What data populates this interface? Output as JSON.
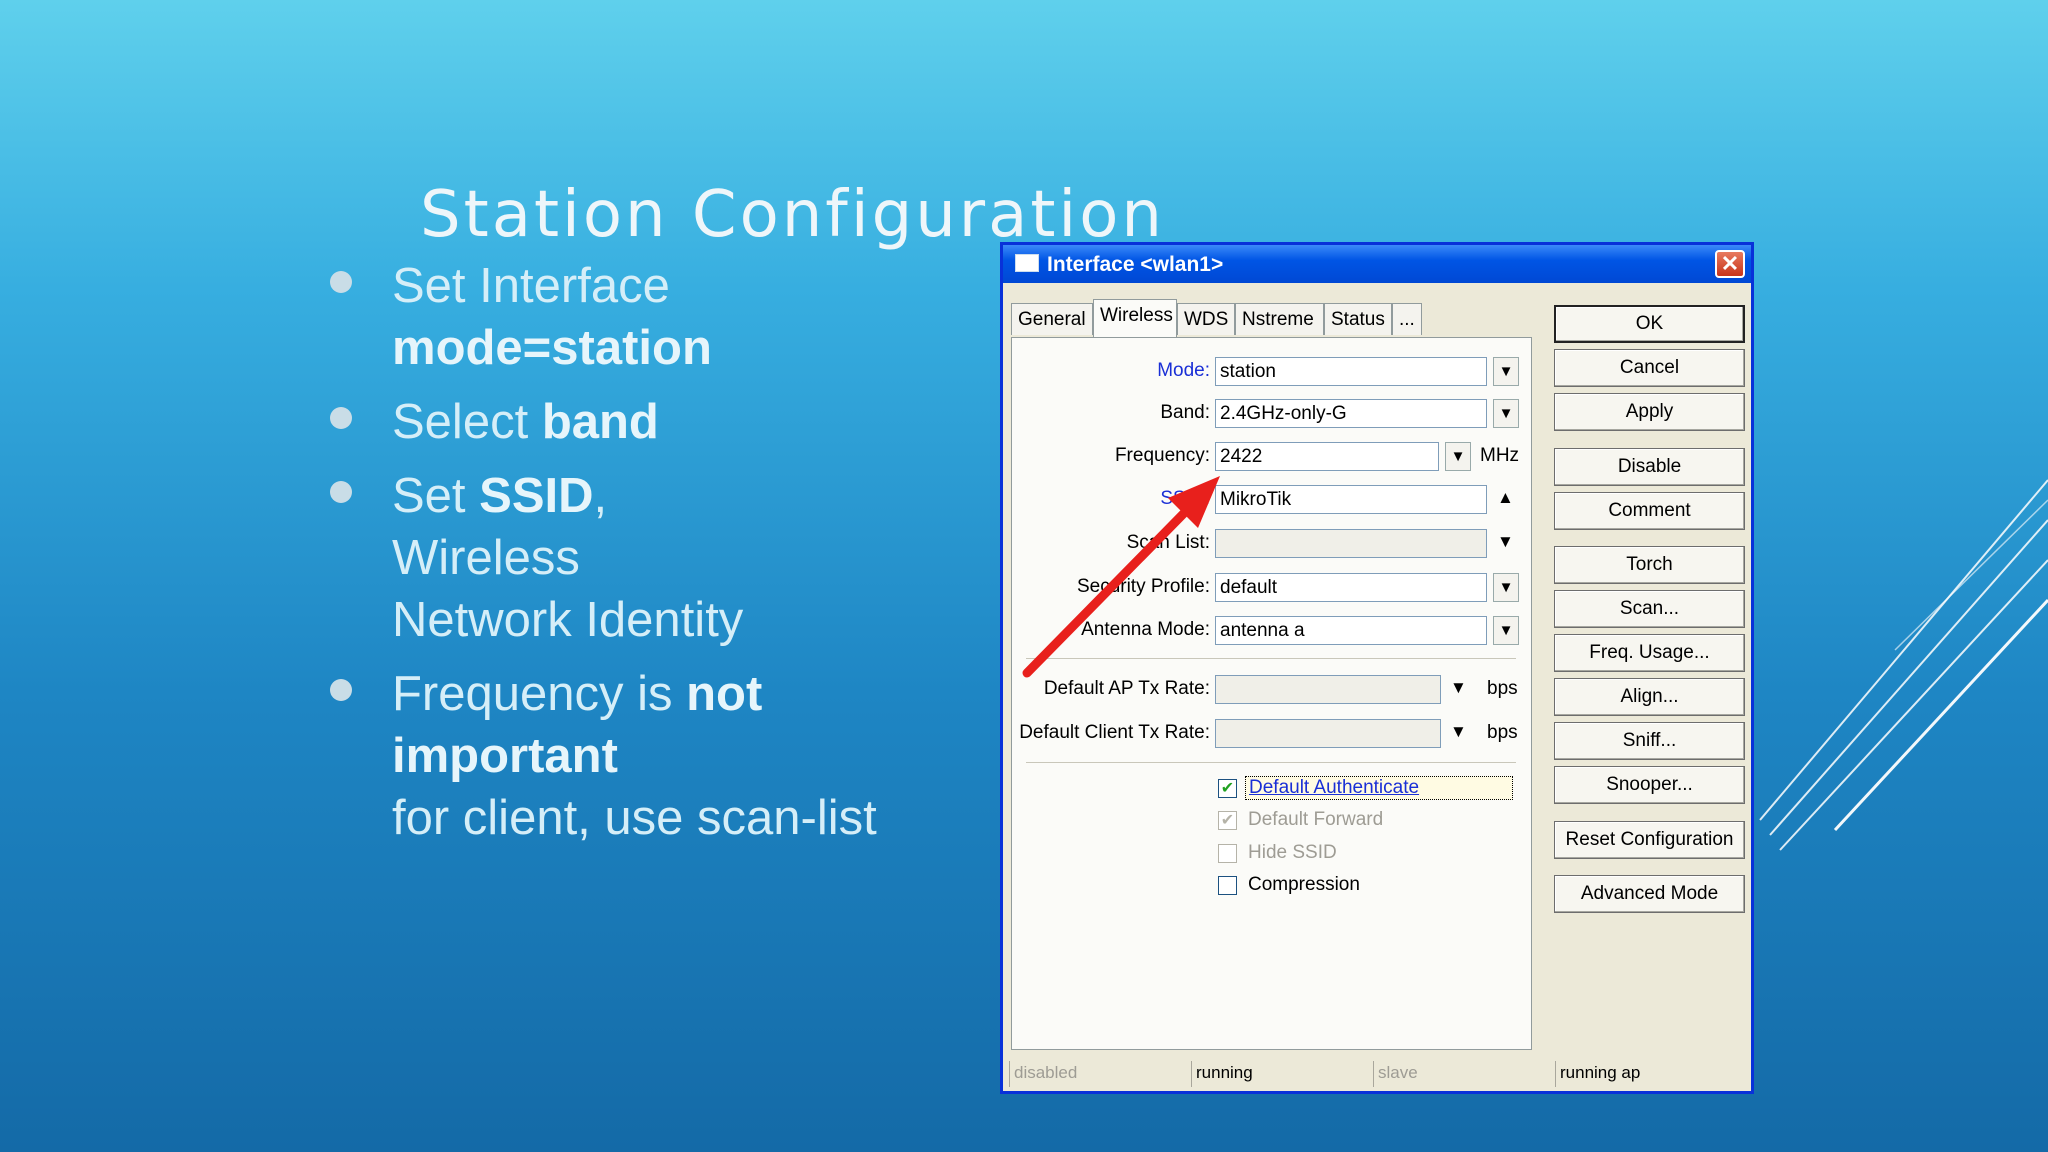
{
  "slide": {
    "title": "Station Configuration",
    "bullets": [
      {
        "lines": [
          [
            {
              "t": "Set Interface",
              "b": false
            }
          ],
          [
            {
              "t": "mode=station",
              "b": true
            }
          ]
        ]
      },
      {
        "lines": [
          [
            {
              "t": "Select ",
              "b": false
            },
            {
              "t": "band",
              "b": true
            }
          ]
        ]
      },
      {
        "lines": [
          [
            {
              "t": "Set ",
              "b": false
            },
            {
              "t": "SSID",
              "b": true
            },
            {
              "t": ",",
              "b": false
            }
          ],
          [
            {
              "t": "Wireless",
              "b": false
            }
          ],
          [
            {
              "t": "Network Identity",
              "b": false
            }
          ]
        ]
      },
      {
        "lines": [
          [
            {
              "t": "Frequency is ",
              "b": false
            },
            {
              "t": "not",
              "b": true
            }
          ],
          [
            {
              "t": "important",
              "b": true
            }
          ],
          [
            {
              "t": "for client, use scan-list",
              "b": false
            }
          ]
        ]
      }
    ]
  },
  "dialog": {
    "title": "Interface <wlan1>",
    "close": "✕",
    "tabs": [
      "General",
      "Wireless",
      "WDS",
      "Nstreme",
      "Status",
      "..."
    ],
    "active_tab": "Wireless",
    "fields": {
      "mode": {
        "label": "Mode:",
        "value": "station",
        "btn": "▼"
      },
      "band": {
        "label": "Band:",
        "value": "2.4GHz-only-G",
        "btn": "▼"
      },
      "frequency": {
        "label": "Frequency:",
        "value": "2422",
        "btn": "▼",
        "unit": "MHz"
      },
      "ssid": {
        "label": "SSID:",
        "value": "MikroTik",
        "btn": "▲"
      },
      "scan_list": {
        "label": "Scan List:",
        "value": "",
        "btn": "▼"
      },
      "security_profile": {
        "label": "Security Profile:",
        "value": "default",
        "btn": "▼"
      },
      "antenna_mode": {
        "label": "Antenna Mode:",
        "value": "antenna a",
        "btn": "▼"
      },
      "default_ap_tx_rate": {
        "label": "Default AP Tx Rate:",
        "value": "",
        "btn": "▼",
        "unit": "bps"
      },
      "default_client_tx_rate": {
        "label": "Default Client Tx Rate:",
        "value": "",
        "btn": "▼",
        "unit": "bps"
      }
    },
    "checkboxes": {
      "default_authenticate": {
        "label": "Default Authenticate",
        "checked": "✔"
      },
      "default_forward": {
        "label": "Default Forward",
        "checked": "✔"
      },
      "hide_ssid": {
        "label": "Hide SSID",
        "checked": ""
      },
      "compression": {
        "label": "Compression",
        "checked": ""
      }
    },
    "buttons": {
      "ok": "OK",
      "cancel": "Cancel",
      "apply": "Apply",
      "disable": "Disable",
      "comment": "Comment",
      "torch": "Torch",
      "scan": "Scan...",
      "freq_usage": "Freq. Usage...",
      "align": "Align...",
      "sniff": "Sniff...",
      "snooper": "Snooper...",
      "reset_configuration": "Reset Configuration",
      "advanced_mode": "Advanced Mode"
    },
    "status": [
      "disabled",
      "running",
      "slave",
      "running ap"
    ]
  },
  "colors": {
    "annotation_arrow": "#e8201c",
    "title_bar": "#0055e5",
    "link_label": "#1a2fd6"
  }
}
